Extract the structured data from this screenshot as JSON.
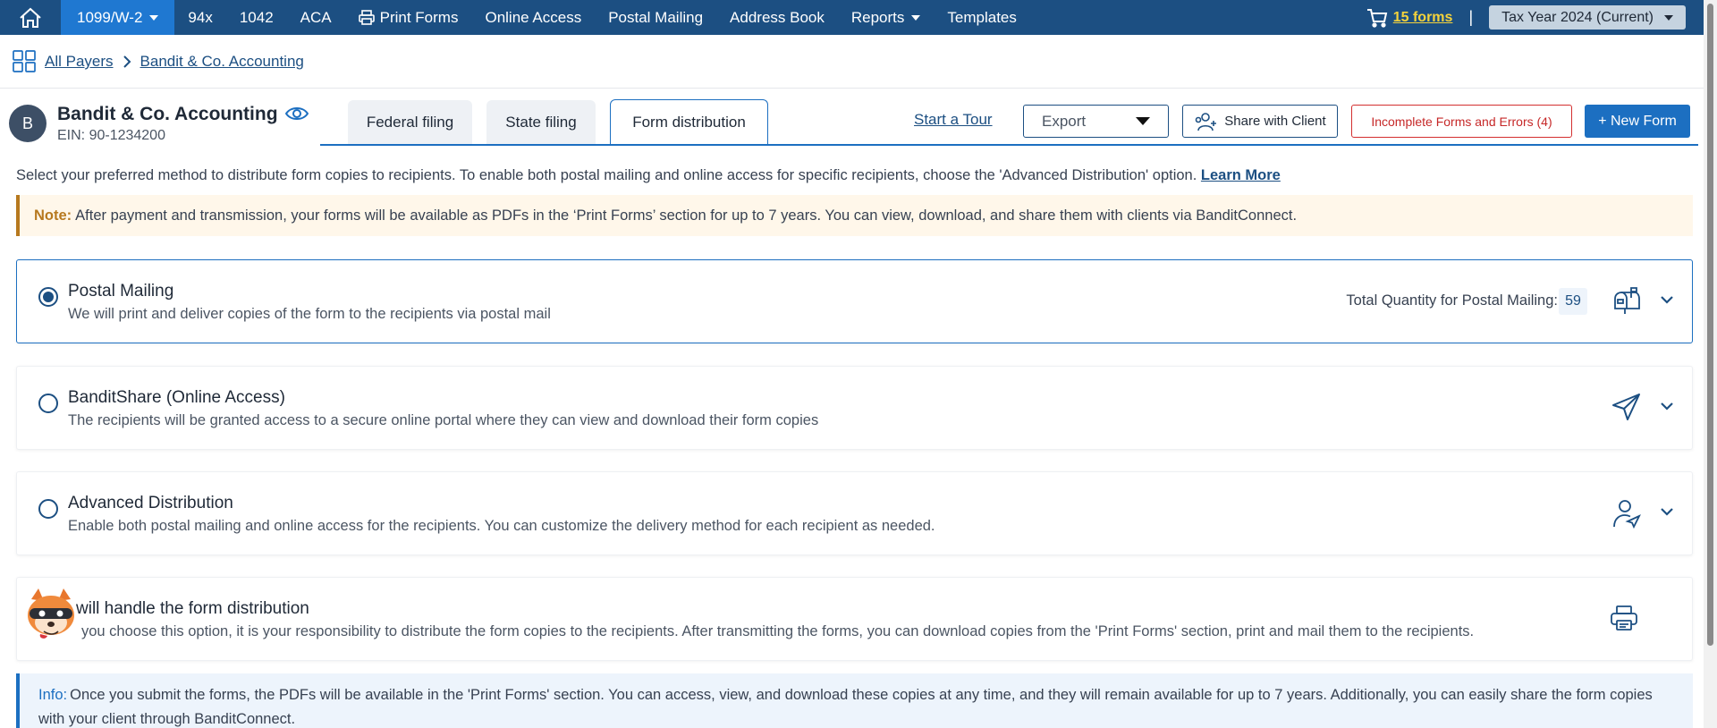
{
  "nav": {
    "items": [
      "1099/W-2",
      "94x",
      "1042",
      "ACA",
      "Print Forms",
      "Online Access",
      "Postal Mailing",
      "Address Book",
      "Reports",
      "Templates"
    ],
    "cart_label": "15 forms",
    "separator": "|",
    "tax_year": "Tax Year 2024 (Current)"
  },
  "breadcrumb": {
    "root": "All Payers",
    "current": "Bandit & Co. Accounting"
  },
  "payer": {
    "initial": "B",
    "name": "Bandit & Co. Accounting",
    "ein": "EIN: 90-1234200"
  },
  "tabs": [
    "Federal filing",
    "State filing",
    "Form distribution"
  ],
  "actions": {
    "tour": "Start a Tour",
    "export": "Export",
    "share": "Share with Client",
    "errors": "Incomplete Forms and Errors (4)",
    "new_form": "+ New Form"
  },
  "intro": {
    "text": "Select your preferred method to distribute form copies to recipients. To enable both postal mailing and online access for specific recipients, choose the 'Advanced Distribution' option.",
    "link": "Learn More"
  },
  "note": {
    "label": "Note:",
    "text": "After payment and transmission, your forms will be available as PDFs in the ‘Print Forms’ section for up to 7 years. You can view, download, and share them with clients via BanditConnect."
  },
  "options": [
    {
      "title": "Postal Mailing",
      "desc": "We will print and deliver copies of the form to the recipients via postal mail",
      "qty_label": "Total Quantity for Postal Mailing:",
      "qty": "59",
      "icon": "mailbox-icon",
      "selected": true
    },
    {
      "title": "BanditShare (Online Access)",
      "desc": "The recipients will be granted access to a secure online portal where they can view and download their form copies",
      "icon": "paper-plane-icon",
      "selected": false
    },
    {
      "title": "Advanced Distribution",
      "desc": "Enable both postal mailing and online access for the recipients. You can customize the delivery method for each recipient as needed.",
      "icon": "user-send-icon",
      "selected": false
    },
    {
      "title": "will handle the form distribution",
      "desc": "you choose this option, it is your responsibility to distribute the form copies to the recipients. After transmitting the forms, you can download copies from the 'Print Forms' section, print and mail them to the recipients.",
      "icon": "printer-icon",
      "selected": false
    }
  ],
  "info": {
    "label": "Info:",
    "text": "Once you submit the forms, the PDFs will be available in the 'Print Forms' section. You can access, view, and download these copies at any time, and they will remain available for up to 7 years. Additionally, you can easily share the form copies with your client through BanditConnect."
  },
  "colors": {
    "nav_bg": "#1c4f82",
    "nav_active": "#1f78d1",
    "primary": "#1c6fc1",
    "error": "#c62828",
    "note_accent": "#b7791f",
    "cart_link": "#f5d33b"
  }
}
